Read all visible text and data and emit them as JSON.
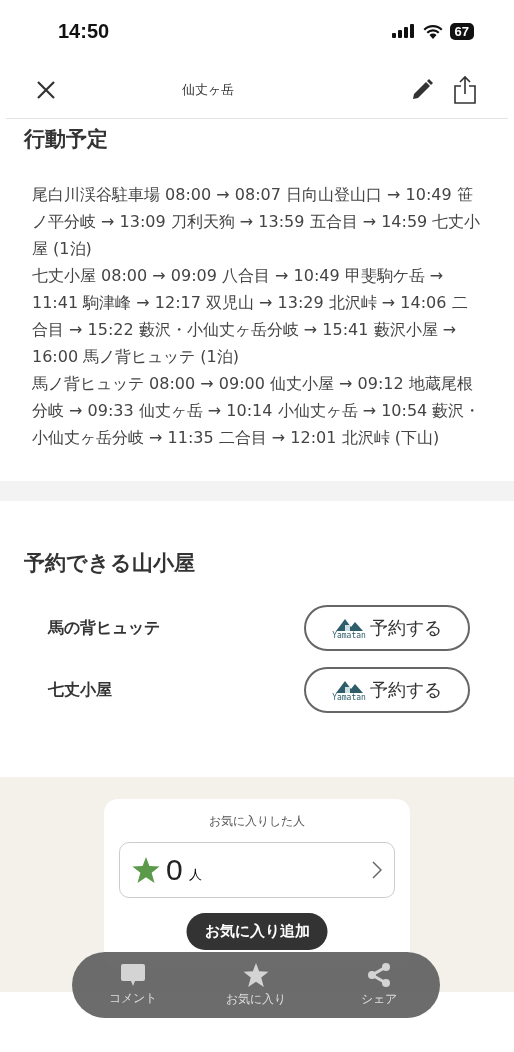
{
  "status_bar": {
    "time": "14:50",
    "battery": "67"
  },
  "nav": {
    "title": "仙丈ヶ岳"
  },
  "schedule": {
    "heading": "行動予定",
    "days": [
      "尾白川渓谷駐車場 08:00 → 08:07 日向山登山口 → 10:49 笹ノ平分岐 → 13:09 刀利天狗 → 13:59 五合目 → 14:59 七丈小屋 (1泊)",
      "七丈小屋 08:00 → 09:09 八合目 → 10:49 甲斐駒ケ岳 → 11:41 駒津峰 → 12:17 双児山 → 13:29 北沢峠 → 14:06 二合目 → 15:22 藪沢・小仙丈ヶ岳分岐 → 15:41 藪沢小屋 → 16:00 馬ノ背ヒュッテ (1泊)",
      "馬ノ背ヒュッテ 08:00 → 09:00 仙丈小屋 → 09:12 地蔵尾根分岐 → 09:33 仙丈ヶ岳 → 10:14 小仙丈ヶ岳 → 10:54 藪沢・小仙丈ヶ岳分岐 → 11:35 二合目 → 12:01 北沢峠 (下山)"
    ]
  },
  "huts": {
    "heading": "予約できる山小屋",
    "items": [
      {
        "name": "馬の背ヒュッテ",
        "logo_text": "Yamatan",
        "button": "予約する"
      },
      {
        "name": "七丈小屋",
        "logo_text": "Yamatan",
        "button": "予約する"
      }
    ]
  },
  "favorites": {
    "title": "お気に入りした人",
    "count": "0",
    "unit": "人",
    "tooltip": "お気に入り追加"
  },
  "tab_bar": [
    {
      "kind": "comment",
      "label": "コメント"
    },
    {
      "kind": "favorite",
      "label": "お気に入り"
    },
    {
      "kind": "share",
      "label": "シェア"
    }
  ]
}
